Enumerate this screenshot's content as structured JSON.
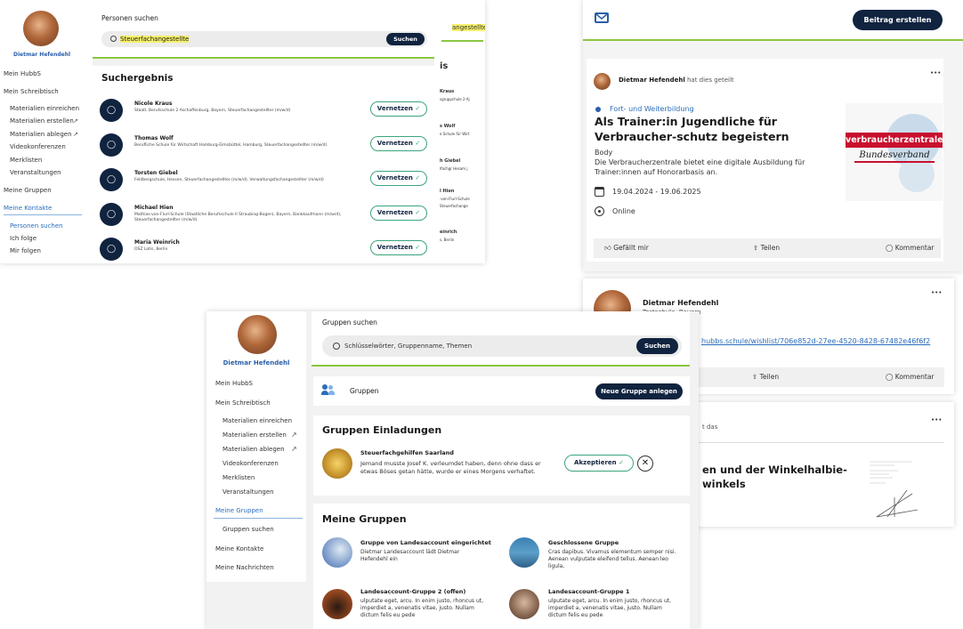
{
  "user": {
    "name": "Dietmar Hefendehl"
  },
  "left_sidebar": {
    "items": [
      {
        "label": "Mein HubbS"
      },
      {
        "label": "Mein Schreibtisch"
      },
      {
        "label": "Materialien einreichen"
      },
      {
        "label": "Materialien erstellen"
      },
      {
        "label": "Materialien ablegen"
      },
      {
        "label": "Videokonferenzen"
      },
      {
        "label": "Merklisten"
      },
      {
        "label": "Veranstaltungen"
      },
      {
        "label": "Meine Gruppen"
      },
      {
        "label": "Meine Kontakte"
      },
      {
        "label": "Personen suchen"
      },
      {
        "label": "Ich folge"
      },
      {
        "label": "Mir folgen"
      }
    ]
  },
  "people_search": {
    "heading": "Personen suchen",
    "query": "Steuerfachangestellte",
    "search_button": "Suchen",
    "results_title": "Suchergebnis",
    "connect_label": "Vernetzen",
    "results": [
      {
        "name": "Nicole Kraus",
        "desc": "Staatl. Berufsschule 2 Aschaffenburg, Bayern, Steuerfachangestellter (m/w/d)"
      },
      {
        "name": "Thomas Wolf",
        "desc": "Berufliche Schule für Wirtschaft Hamburg-Eimsbüttel, Hamburg, Steuerfachangestellter (m/w/d)"
      },
      {
        "name": "Torsten Giebel",
        "desc": "Feldbergschule, Hessen, Steuerfachangestellter (m/w/d), Verwaltungsfachangestellter (m/w/d)"
      },
      {
        "name": "Michael Hien",
        "desc": "Mathias-von-Flurl-Schule (Staatliche Berufsschule II Straubing-Bogen), Bayern, Bankkaufmann (m/w/d), Steuerfachangestellter (m/w/d)"
      },
      {
        "name": "Maria Weinrich",
        "desc": "OSZ Lotis, Berlin"
      }
    ],
    "bg_fragments": [
      "angestellte",
      "is",
      "Kraus",
      "sgruppchule 2 Aj",
      "s Wolf",
      "e Schule für Wirt",
      "h Giebel",
      "lfachgr Hesam j",
      "l Hien",
      "-von-Flurl-Schule",
      "Steuerfachange",
      "einrich",
      "s, Berlin"
    ]
  },
  "feed": {
    "create_post_button": "Beitrag erstellen",
    "post1": {
      "shared_by_name": "Dietmar Hefendehl",
      "shared_suffix": "hat dies geteilt",
      "category": "Fort- und Weiterbildung",
      "title": "Als Trainer:in Jugendliche für Verbraucher-schutz begeistern",
      "body_label": "Body",
      "body": "Die Verbraucherzentrale bietet eine digitale Ausbildung für Trainer:innen auf Honorarbasis an.",
      "dates": "19.04.2024 - 19.06.2025",
      "location": "Online",
      "logo_top": "verbraucherzentrale",
      "logo_bottom": "Bundesverband",
      "like": "Gefällt mir",
      "share": "Teilen",
      "comment": "Kommentar"
    },
    "post2": {
      "name": "Dietmar Hefendehl",
      "school": "Testschule, Bayern",
      "link": "hubbs.schule/wishlist/706e852d-27ee-4520-8428-67482e46f6f2",
      "share": "Teilen",
      "comment": "Kommentar"
    },
    "post3": {
      "shared_suffix": "t das",
      "title_line1": "en und der Winkelhalbie-",
      "title_line2": "winkels"
    },
    "menu_dots": "•••"
  },
  "groups_page": {
    "search_heading": "Gruppen suchen",
    "search_placeholder": "Schlüsselwörter, Gruppenname, Themen",
    "search_button": "Suchen",
    "groups_label": "Gruppen",
    "new_group_button": "Neue Gruppe anlegen",
    "invites_title": "Gruppen Einladungen",
    "invite": {
      "name": "Steuerfachgehilfen Saarland",
      "desc": "Jemand musste Josef K. verleumdet haben, denn ohne dass er etwas Böses getan hätte, wurde er eines Morgens verhaftet.",
      "accept": "Akzeptieren"
    },
    "my_groups_title": "Meine Gruppen",
    "groups": [
      {
        "name": "Gruppe von Landesaccount eingerichtet",
        "desc": "Dietmar Landesaccount lädt Dietmar Hefendehl ein"
      },
      {
        "name": "Geschlossene Gruppe",
        "desc": "Cras dapibus. Vivamus elementum semper nisi. Aenean vulputate eleifend tellus. Aenean leo ligula,"
      },
      {
        "name": "Landesaccount-Gruppe 2 (offen)",
        "desc": "ulputate eget, arcu. In enim justo, rhoncus ut, imperdiet a, venenatis vitae, justo. Nullam dictum felis eu pede"
      },
      {
        "name": "Landesaccount-Gruppe 1",
        "desc": "ulputate eget, arcu. In enim justo, rhoncus ut, imperdiet a, venenatis vitae, justo. Nullam dictum felis eu pede"
      }
    ],
    "sidebar": [
      {
        "label": "Mein HubbS"
      },
      {
        "label": "Mein Schreibtisch"
      },
      {
        "label": "Materialien einreichen"
      },
      {
        "label": "Materialien erstellen"
      },
      {
        "label": "Materialien ablegen"
      },
      {
        "label": "Videokonferenzen"
      },
      {
        "label": "Merklisten"
      },
      {
        "label": "Veranstaltungen"
      },
      {
        "label": "Meine Gruppen"
      },
      {
        "label": "Gruppen suchen"
      },
      {
        "label": "Meine Kontakte"
      },
      {
        "label": "Meine Nachrichten"
      }
    ]
  },
  "colors": {
    "navy": "#10233f",
    "green": "#8cc63f",
    "teal": "#3ba57e",
    "link_blue": "#2a6ebb",
    "highlight": "#f5f06a"
  }
}
